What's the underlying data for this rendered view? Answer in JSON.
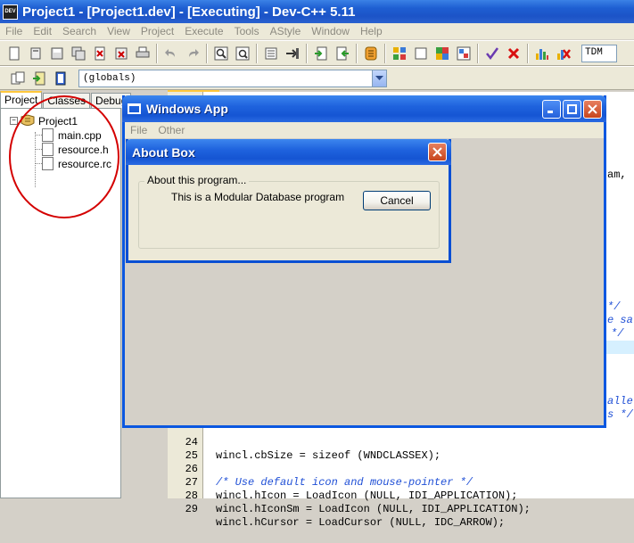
{
  "ide": {
    "title": "Project1 - [Project1.dev] - [Executing] - Dev-C++ 5.11",
    "icon_text": "DEV",
    "menu": [
      "File",
      "Edit",
      "Search",
      "View",
      "Project",
      "Execute",
      "Tools",
      "AStyle",
      "Window",
      "Help"
    ],
    "compiler_value": "TDM",
    "scope_value": "(globals)",
    "project_tabs": [
      "Project",
      "Classes",
      "Debug"
    ],
    "tree": {
      "root": "Project1",
      "files": [
        "main.cpp",
        "resource.h",
        "resource.rc"
      ]
    },
    "code_fragments": [
      "am,",
      "*/",
      "e sa",
      "*/",
      "alle",
      "s */"
    ],
    "code_lines": [
      {
        "num": "24",
        "text": "wincl.cbSize = sizeof (WNDCLASSEX);",
        "comment": false
      },
      {
        "num": "25",
        "text": "",
        "comment": false
      },
      {
        "num": "26",
        "text": "/* Use default icon and mouse-pointer */",
        "comment": true
      },
      {
        "num": "27",
        "text": "wincl.hIcon = LoadIcon (NULL, IDI_APPLICATION);",
        "comment": false
      },
      {
        "num": "28",
        "text": "wincl.hIconSm = LoadIcon (NULL, IDI_APPLICATION);",
        "comment": false
      },
      {
        "num": "29",
        "text": "wincl.hCursor = LoadCursor (NULL, IDC_ARROW);",
        "comment": false
      }
    ]
  },
  "winapp": {
    "title": "Windows App",
    "menu": [
      "File",
      "Other"
    ]
  },
  "about": {
    "title": "About Box",
    "group_label": "About this program...",
    "text": "This is a Modular Database program",
    "cancel_label": "Cancel"
  },
  "colors": {
    "xp_title_blue": "#1f63de",
    "annotation_red": "#d40000",
    "comment_blue": "#1f4fd6"
  }
}
